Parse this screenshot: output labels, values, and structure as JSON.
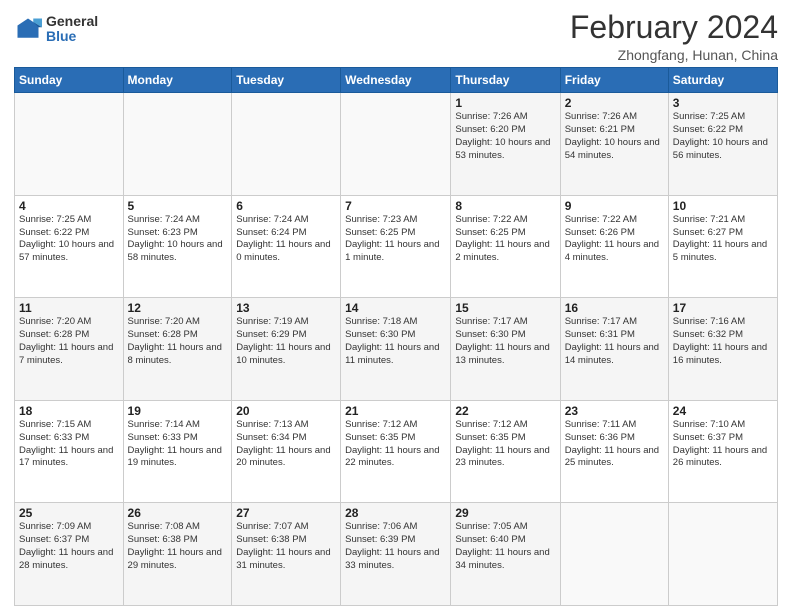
{
  "header": {
    "logo_general": "General",
    "logo_blue": "Blue",
    "title": "February 2024",
    "subtitle": "Zhongfang, Hunan, China"
  },
  "weekdays": [
    "Sunday",
    "Monday",
    "Tuesday",
    "Wednesday",
    "Thursday",
    "Friday",
    "Saturday"
  ],
  "weeks": [
    [
      {
        "day": "",
        "sunrise": "",
        "sunset": "",
        "daylight": ""
      },
      {
        "day": "",
        "sunrise": "",
        "sunset": "",
        "daylight": ""
      },
      {
        "day": "",
        "sunrise": "",
        "sunset": "",
        "daylight": ""
      },
      {
        "day": "",
        "sunrise": "",
        "sunset": "",
        "daylight": ""
      },
      {
        "day": "1",
        "sunrise": "7:26 AM",
        "sunset": "6:20 PM",
        "daylight": "10 hours and 53 minutes."
      },
      {
        "day": "2",
        "sunrise": "7:26 AM",
        "sunset": "6:21 PM",
        "daylight": "10 hours and 54 minutes."
      },
      {
        "day": "3",
        "sunrise": "7:25 AM",
        "sunset": "6:22 PM",
        "daylight": "10 hours and 56 minutes."
      }
    ],
    [
      {
        "day": "4",
        "sunrise": "7:25 AM",
        "sunset": "6:22 PM",
        "daylight": "10 hours and 57 minutes."
      },
      {
        "day": "5",
        "sunrise": "7:24 AM",
        "sunset": "6:23 PM",
        "daylight": "10 hours and 58 minutes."
      },
      {
        "day": "6",
        "sunrise": "7:24 AM",
        "sunset": "6:24 PM",
        "daylight": "11 hours and 0 minutes."
      },
      {
        "day": "7",
        "sunrise": "7:23 AM",
        "sunset": "6:25 PM",
        "daylight": "11 hours and 1 minute."
      },
      {
        "day": "8",
        "sunrise": "7:22 AM",
        "sunset": "6:25 PM",
        "daylight": "11 hours and 2 minutes."
      },
      {
        "day": "9",
        "sunrise": "7:22 AM",
        "sunset": "6:26 PM",
        "daylight": "11 hours and 4 minutes."
      },
      {
        "day": "10",
        "sunrise": "7:21 AM",
        "sunset": "6:27 PM",
        "daylight": "11 hours and 5 minutes."
      }
    ],
    [
      {
        "day": "11",
        "sunrise": "7:20 AM",
        "sunset": "6:28 PM",
        "daylight": "11 hours and 7 minutes."
      },
      {
        "day": "12",
        "sunrise": "7:20 AM",
        "sunset": "6:28 PM",
        "daylight": "11 hours and 8 minutes."
      },
      {
        "day": "13",
        "sunrise": "7:19 AM",
        "sunset": "6:29 PM",
        "daylight": "11 hours and 10 minutes."
      },
      {
        "day": "14",
        "sunrise": "7:18 AM",
        "sunset": "6:30 PM",
        "daylight": "11 hours and 11 minutes."
      },
      {
        "day": "15",
        "sunrise": "7:17 AM",
        "sunset": "6:30 PM",
        "daylight": "11 hours and 13 minutes."
      },
      {
        "day": "16",
        "sunrise": "7:17 AM",
        "sunset": "6:31 PM",
        "daylight": "11 hours and 14 minutes."
      },
      {
        "day": "17",
        "sunrise": "7:16 AM",
        "sunset": "6:32 PM",
        "daylight": "11 hours and 16 minutes."
      }
    ],
    [
      {
        "day": "18",
        "sunrise": "7:15 AM",
        "sunset": "6:33 PM",
        "daylight": "11 hours and 17 minutes."
      },
      {
        "day": "19",
        "sunrise": "7:14 AM",
        "sunset": "6:33 PM",
        "daylight": "11 hours and 19 minutes."
      },
      {
        "day": "20",
        "sunrise": "7:13 AM",
        "sunset": "6:34 PM",
        "daylight": "11 hours and 20 minutes."
      },
      {
        "day": "21",
        "sunrise": "7:12 AM",
        "sunset": "6:35 PM",
        "daylight": "11 hours and 22 minutes."
      },
      {
        "day": "22",
        "sunrise": "7:12 AM",
        "sunset": "6:35 PM",
        "daylight": "11 hours and 23 minutes."
      },
      {
        "day": "23",
        "sunrise": "7:11 AM",
        "sunset": "6:36 PM",
        "daylight": "11 hours and 25 minutes."
      },
      {
        "day": "24",
        "sunrise": "7:10 AM",
        "sunset": "6:37 PM",
        "daylight": "11 hours and 26 minutes."
      }
    ],
    [
      {
        "day": "25",
        "sunrise": "7:09 AM",
        "sunset": "6:37 PM",
        "daylight": "11 hours and 28 minutes."
      },
      {
        "day": "26",
        "sunrise": "7:08 AM",
        "sunset": "6:38 PM",
        "daylight": "11 hours and 29 minutes."
      },
      {
        "day": "27",
        "sunrise": "7:07 AM",
        "sunset": "6:38 PM",
        "daylight": "11 hours and 31 minutes."
      },
      {
        "day": "28",
        "sunrise": "7:06 AM",
        "sunset": "6:39 PM",
        "daylight": "11 hours and 33 minutes."
      },
      {
        "day": "29",
        "sunrise": "7:05 AM",
        "sunset": "6:40 PM",
        "daylight": "11 hours and 34 minutes."
      },
      {
        "day": "",
        "sunrise": "",
        "sunset": "",
        "daylight": ""
      },
      {
        "day": "",
        "sunrise": "",
        "sunset": "",
        "daylight": ""
      }
    ]
  ],
  "colors": {
    "header_bg": "#2a6db5",
    "header_text": "#ffffff",
    "odd_row": "#f5f5f5",
    "even_row": "#ffffff"
  }
}
